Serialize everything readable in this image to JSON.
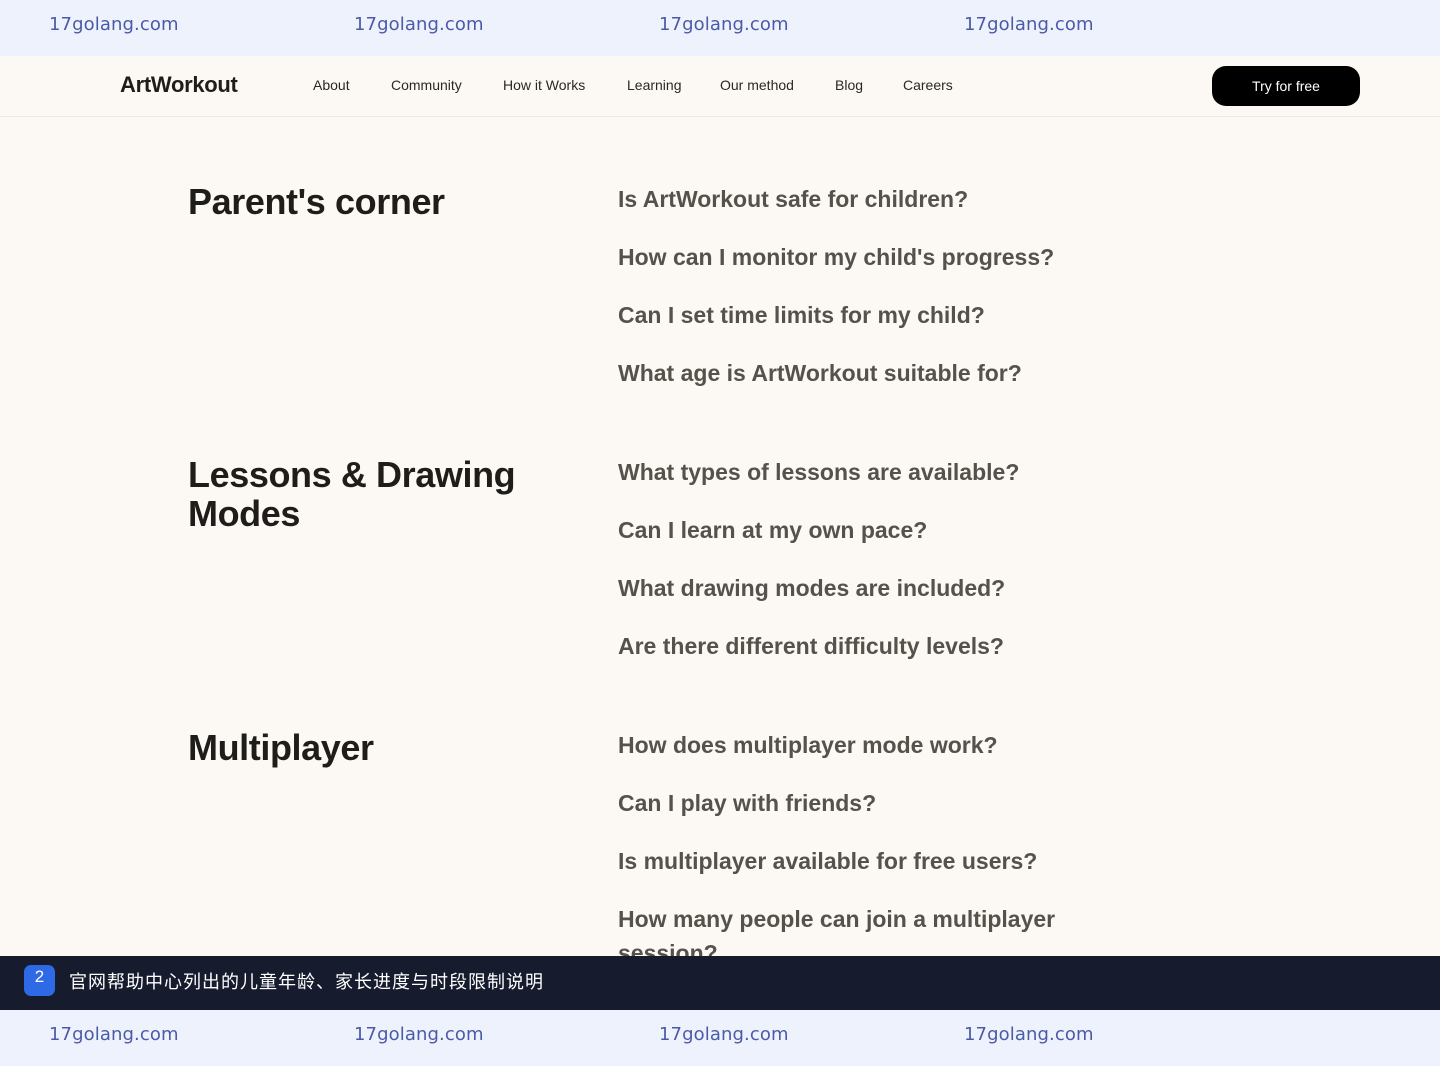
{
  "watermark": {
    "top": [
      "17golang.com",
      "17golang.com",
      "17golang.com",
      "17golang.com"
    ],
    "bottom": [
      "17golang.com",
      "17golang.com",
      "17golang.com",
      "17golang.com"
    ]
  },
  "nav": {
    "logo": "ArtWorkout",
    "links": [
      "About",
      "Community",
      "How it Works",
      "Learning",
      "Our method",
      "Blog",
      "Careers"
    ],
    "cta": "Try for free"
  },
  "sections": [
    {
      "title": "Parent's corner",
      "questions": [
        "Is ArtWorkout safe for children?",
        "How can I monitor my child's progress?",
        "Can I set time limits for my child?",
        "What age is ArtWorkout suitable for?"
      ]
    },
    {
      "title": "Lessons & Drawing Modes",
      "questions": [
        "What types of lessons are available?",
        "Can I learn at my own pace?",
        "What drawing modes are included?",
        "Are there different difficulty levels?"
      ]
    },
    {
      "title": "Multiplayer",
      "questions": [
        "How does multiplayer mode work?",
        "Can I play with friends?",
        "Is multiplayer available for free users?",
        "How many people can join a multiplayer session?"
      ]
    }
  ],
  "caption": {
    "badge": "2",
    "text": "官网帮助中心列出的儿童年龄、家长进度与时段限制说明"
  }
}
